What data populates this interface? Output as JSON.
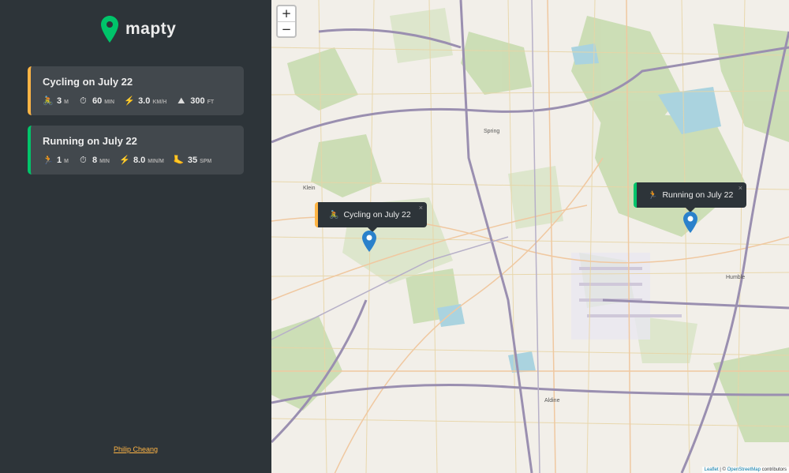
{
  "app": {
    "name": "mapty"
  },
  "workouts": [
    {
      "type": "cycling",
      "title": "Cycling on July 22",
      "color": "#ffb545",
      "details": [
        {
          "icon": "🚴",
          "icon_name": "cyclist-icon",
          "value": "3",
          "unit": "M"
        },
        {
          "icon": "⏱",
          "icon_name": "stopwatch-icon",
          "value": "60",
          "unit": "MIN"
        },
        {
          "icon": "⚡",
          "icon_name": "lightning-icon",
          "value": "3.0",
          "unit": "KM/H"
        },
        {
          "icon": "⛰",
          "icon_name": "mountain-icon",
          "value": "300",
          "unit": "FT"
        }
      ]
    },
    {
      "type": "running",
      "title": "Running on July 22",
      "color": "#00c46a",
      "details": [
        {
          "icon": "🏃",
          "icon_name": "runner-icon",
          "value": "1",
          "unit": "M"
        },
        {
          "icon": "⏱",
          "icon_name": "stopwatch-icon",
          "value": "8",
          "unit": "MIN"
        },
        {
          "icon": "⚡",
          "icon_name": "lightning-icon",
          "value": "8.0",
          "unit": "MIN/M"
        },
        {
          "icon": "🦶",
          "icon_name": "footprint-icon",
          "value": "35",
          "unit": "SPM"
        }
      ]
    }
  ],
  "footer": {
    "author": "Philip Cheang"
  },
  "map": {
    "zoom_in": "+",
    "zoom_out": "−",
    "popups": {
      "cycling": {
        "icon": "🚴",
        "label": "Cycling on July 22",
        "close": "×"
      },
      "running": {
        "icon": "🏃",
        "label": "Running on July 22",
        "close": "×"
      }
    },
    "places": [
      "Spring",
      "Humble",
      "Aldine",
      "Klein"
    ],
    "attribution": {
      "leaflet": "Leaflet",
      "separator": " | © ",
      "osm": "OpenStreetMap",
      "suffix": " contributors"
    }
  }
}
